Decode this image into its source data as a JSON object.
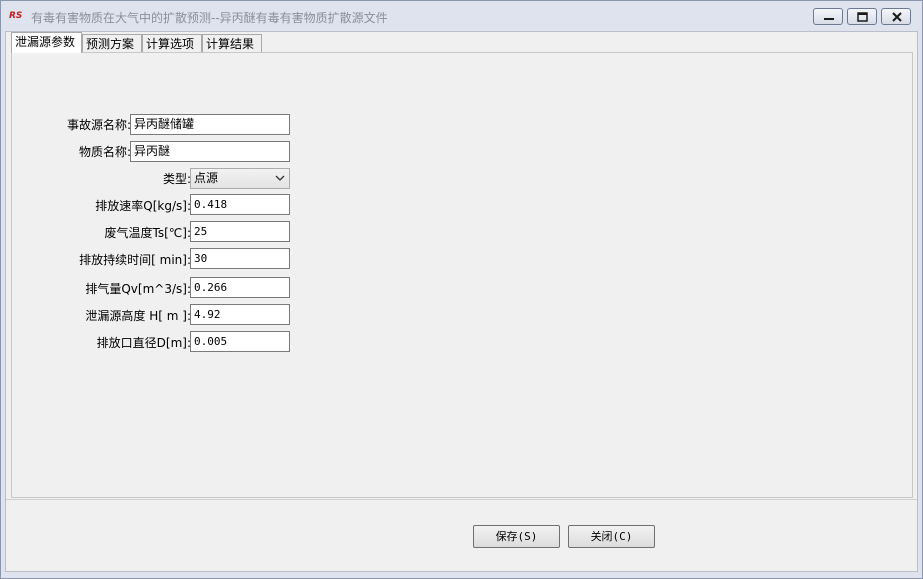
{
  "window": {
    "icon_text": "RS",
    "title": "有毒有害物质在大气中的扩散预测--异丙醚有毒有害物质扩散源文件"
  },
  "tabs": [
    {
      "label": "泄漏源参数",
      "active": true
    },
    {
      "label": "预测方案",
      "active": false
    },
    {
      "label": "计算选项",
      "active": false
    },
    {
      "label": "计算结果",
      "active": false
    }
  ],
  "form": {
    "source_name": {
      "label": "事故源名称:",
      "value": "异丙醚储罐"
    },
    "substance": {
      "label": "物质名称:",
      "value": "异丙醚"
    },
    "type": {
      "label": "类型:",
      "value": "点源"
    },
    "release_rate": {
      "label": "排放速率Q[kg/s]:",
      "value": "0.418"
    },
    "gas_temp": {
      "label": "废气温度Ts[℃]:",
      "value": "25"
    },
    "duration": {
      "label": "排放持续时间[ min]:",
      "value": "30"
    },
    "gas_volume": {
      "label": "排气量Qv[m^3/s]:",
      "value": "0.266"
    },
    "height": {
      "label": "泄漏源高度 H[  m ]:",
      "value": "4.92"
    },
    "diameter": {
      "label": "排放口直径D[m]:",
      "value": "0.005"
    }
  },
  "buttons": {
    "save": "保存(S)",
    "close": "关闭(C)"
  }
}
